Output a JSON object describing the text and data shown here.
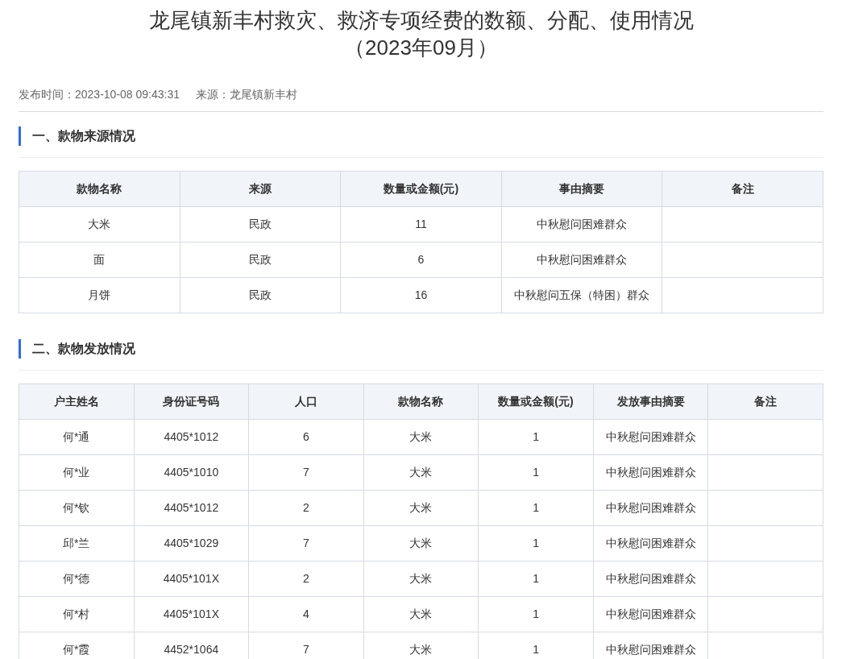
{
  "title": {
    "line_1": "龙尾镇新丰村救灾、救济专项经费的数额、分配、使用情况",
    "line_2": "（2023年09月）"
  },
  "meta": {
    "published": "发布时间：2023-10-08 09:43:31",
    "source": "来源：龙尾镇新丰村"
  },
  "sections": [
    {
      "heading": "一、款物来源情况",
      "table": {
        "columns": [
          "款物名称",
          "来源",
          "数量或金额(元)",
          "事由摘要",
          "备注"
        ],
        "rows": [
          [
            "大米",
            "民政",
            "11",
            "中秋慰问困难群众",
            ""
          ],
          [
            "面",
            "民政",
            "6",
            "中秋慰问困难群众",
            ""
          ],
          [
            "月饼",
            "民政",
            "16",
            "中秋慰问五保（特困）群众",
            ""
          ]
        ]
      }
    },
    {
      "heading": "二、款物发放情况",
      "table": {
        "columns": [
          "户主姓名",
          "身份证号码",
          "人口",
          "款物名称",
          "数量或金额(元)",
          "发放事由摘要",
          "备注"
        ],
        "rows": [
          [
            "何*通",
            "4405*1012",
            "6",
            "大米",
            "1",
            "中秋慰问困难群众",
            ""
          ],
          [
            "何*业",
            "4405*1010",
            "7",
            "大米",
            "1",
            "中秋慰问困难群众",
            ""
          ],
          [
            "何*钦",
            "4405*1012",
            "2",
            "大米",
            "1",
            "中秋慰问困难群众",
            ""
          ],
          [
            "邱*兰",
            "4405*1029",
            "7",
            "大米",
            "1",
            "中秋慰问困难群众",
            ""
          ],
          [
            "何*德",
            "4405*101X",
            "2",
            "大米",
            "1",
            "中秋慰问困难群众",
            ""
          ],
          [
            "何*村",
            "4405*101X",
            "4",
            "大米",
            "1",
            "中秋慰问困难群众",
            ""
          ],
          [
            "何*霞",
            "4452*1064",
            "7",
            "大米",
            "1",
            "中秋慰问困难群众",
            ""
          ]
        ]
      }
    }
  ]
}
